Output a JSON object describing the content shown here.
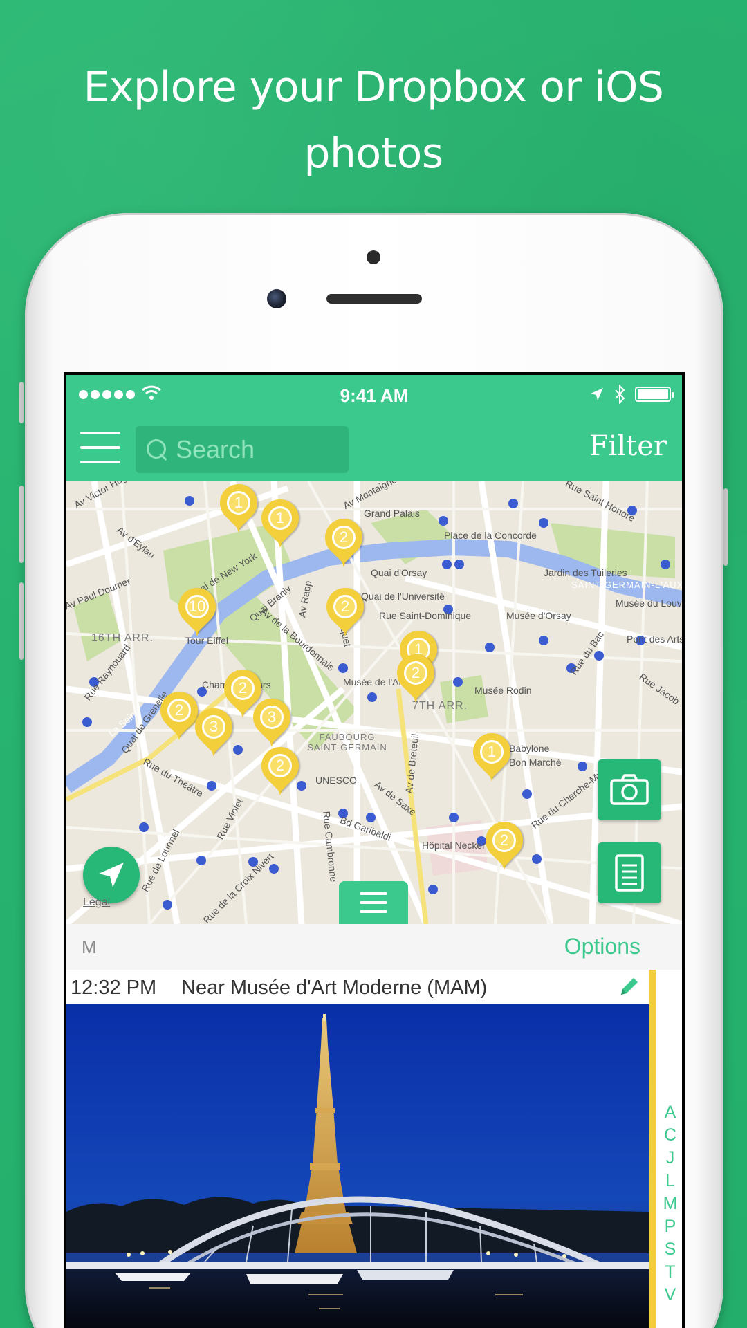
{
  "headline": {
    "line1": "Explore your Dropbox or iOS",
    "line2": "photos"
  },
  "colors": {
    "brand_green": "#3cc98e",
    "background_green": "#27b26f",
    "pin_yellow": "#f3cf3b"
  },
  "status_bar": {
    "time": "9:41 AM",
    "wifi_icon": "wifi-icon",
    "location_icon": "location-arrow-icon",
    "bluetooth_icon": "bluetooth-icon",
    "battery_icon": "battery-icon"
  },
  "navbar": {
    "menu_icon": "hamburger-menu-icon",
    "search_placeholder": "Search",
    "filter_label": "Filter"
  },
  "map": {
    "street_labels": [
      "Av Victor Hugo",
      "Av d'Eylau",
      "Av Paul Doumer",
      "16TH ARR.",
      "Rue Raynouard",
      "La Seine",
      "Quai de New York",
      "Quai Branly",
      "Tour Eiffel",
      "Champ de Mars",
      "Quai de Grenelle",
      "Rue du Théâtre",
      "Rue de Lourmel",
      "Rue de la Croix Nivert",
      "Rue Violet",
      "Av de la Bourdonnais",
      "Av Rapp",
      "Av Bosquet",
      "FAUBOURG SAINT-GERMAIN",
      "UNESCO",
      "Bd Garibaldi",
      "Rue Cambronne",
      "Av de Saxe",
      "Av de Breteuil",
      "Hôpital Necker",
      "Musée de l'Armée",
      "7TH ARR.",
      "Musée Rodin",
      "Rue Saint-Dominique",
      "Quai d'Orsay",
      "Quai de l'Université",
      "Grand Palais",
      "Av Montaigne",
      "Place de la Concorde",
      "Rue Saint Honoré",
      "Jardin des Tuileries",
      "SAINT-GERMAIN-L'AUX",
      "Musée du Louvre",
      "Musée d'Orsay",
      "Pont des Arts",
      "Rue du Bac",
      "Rue Jacob",
      "Babylone",
      "Bon Marché",
      "Rue du Cherche-Midi",
      "La Seine"
    ],
    "pins": [
      {
        "count": "1"
      },
      {
        "count": "1"
      },
      {
        "count": "2"
      },
      {
        "count": "10"
      },
      {
        "count": "2"
      },
      {
        "count": "1"
      },
      {
        "count": "2"
      },
      {
        "count": "2"
      },
      {
        "count": "2"
      },
      {
        "count": "3"
      },
      {
        "count": "3"
      },
      {
        "count": "2"
      },
      {
        "count": "1"
      },
      {
        "count": "2"
      }
    ],
    "locate_button_icon": "navigation-arrow-icon",
    "camera_button_icon": "camera-icon",
    "notes_button_icon": "document-icon",
    "drawer_handle_icon": "drawer-handle-icon",
    "legal_label": "Legal"
  },
  "list": {
    "section_letter": "M",
    "options_label": "Options",
    "item": {
      "time": "12:32 PM",
      "place": "Near Musée d'Art Moderne (MAM)",
      "edit_icon": "pencil-icon"
    },
    "index_letters": [
      "A",
      "C",
      "J",
      "L",
      "M",
      "P",
      "S",
      "T",
      "V"
    ]
  }
}
